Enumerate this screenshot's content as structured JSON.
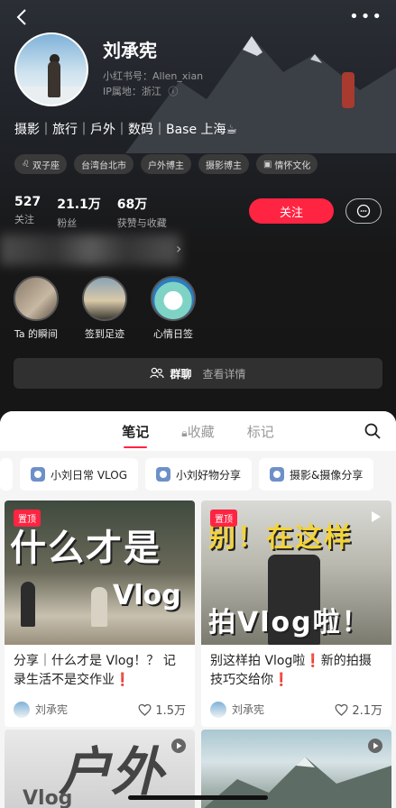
{
  "profile": {
    "name": "刘承宪",
    "red_id": "小红书号：Allen_xian",
    "ip_location": "IP属地：浙江",
    "bio": "摄影｜旅行｜戶外｜数码｜Base 上海☕",
    "tags": [
      {
        "icon": "♌",
        "label": "双子座"
      },
      {
        "icon": "",
        "label": "台湾台北市"
      },
      {
        "icon": "",
        "label": "户外博主"
      },
      {
        "icon": "",
        "label": "摄影博主"
      },
      {
        "icon": "▣",
        "label": "情怀文化"
      }
    ],
    "stats": [
      {
        "value": "527",
        "label": "关注"
      },
      {
        "value": "21.1万",
        "label": "粉丝"
      },
      {
        "value": "68万",
        "label": "获赞与收藏"
      }
    ],
    "follow_label": "关注"
  },
  "highlights": [
    {
      "label": "Ta 的瞬间"
    },
    {
      "label": "签到足迹"
    },
    {
      "label": "心情日签"
    }
  ],
  "group_bar": {
    "label": "群聊",
    "sub": "查看详情"
  },
  "tabs": [
    {
      "label": "笔记"
    },
    {
      "label": "收藏"
    },
    {
      "label": "标记"
    }
  ],
  "collections": [
    {
      "label": "小刘日常 VLOG"
    },
    {
      "label": "小刘好物分享"
    },
    {
      "label": "摄影&摄像分享"
    }
  ],
  "notes": [
    {
      "pin": "置顶",
      "cover_text": "什么才是",
      "cover_text2": "Vlog",
      "title": "分享｜什么才是 Vlog！？ 记录生活不是交作业",
      "title_mark": "❗",
      "author": "刘承宪",
      "likes": "1.5万"
    },
    {
      "pin": "置顶",
      "cover_text": "别！在这样",
      "cover_text2": "拍Vlog啦！",
      "title": "别这样拍 Vlog啦❗新的拍摄技巧交给你",
      "title_mark": "❗",
      "author": "刘承宪",
      "likes": "2.1万"
    },
    {
      "cover_text": "户外",
      "cover_text2": "Vlog"
    },
    {
      "cover_text": ""
    }
  ],
  "colors": {
    "accent": "#ff2442",
    "panel_bg": "#f5f5f5"
  }
}
